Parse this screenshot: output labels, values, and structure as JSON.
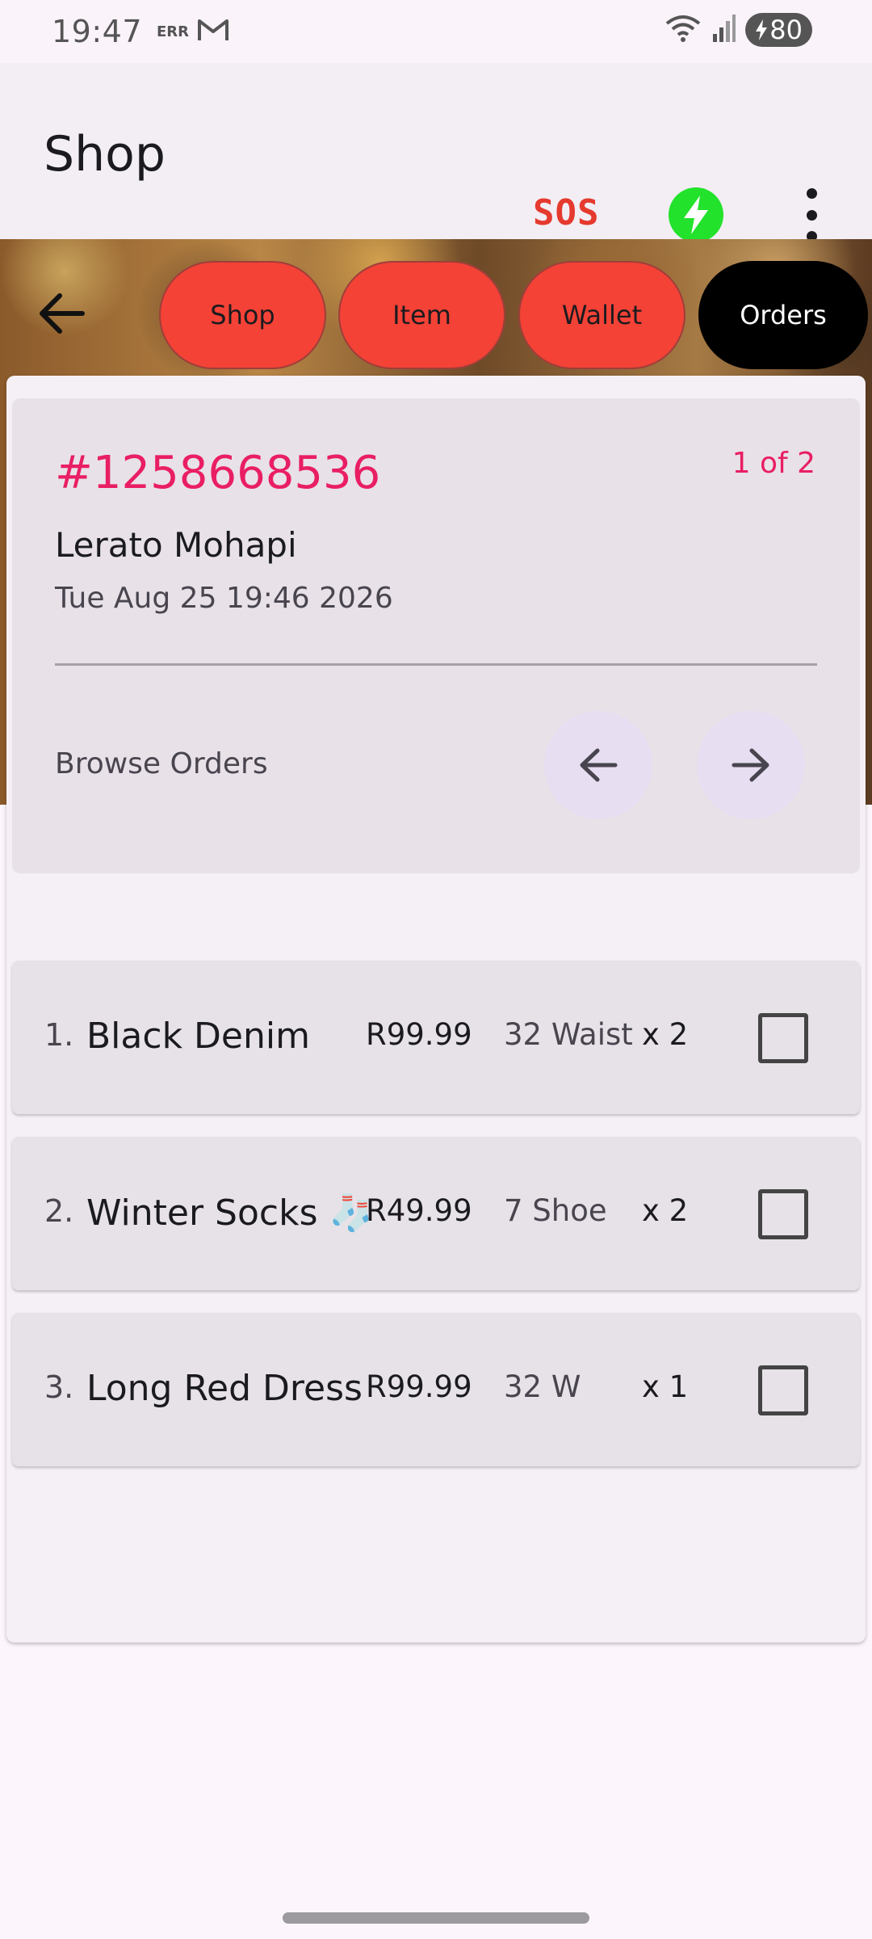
{
  "status_bar": {
    "time": "19:47",
    "carrier_text": "ERR",
    "battery": "80"
  },
  "app_bar": {
    "title": "Shop",
    "sos_label": "SOS"
  },
  "tabs": [
    {
      "label": "Shop",
      "active": false
    },
    {
      "label": "Item",
      "active": false
    },
    {
      "label": "Wallet",
      "active": false
    },
    {
      "label": "Orders",
      "active": true
    }
  ],
  "order": {
    "id": "#1258668536",
    "page_indicator": "1 of 2",
    "customer_name": "Lerato Mohapi",
    "datetime": "Tue Aug 25 19:46 2026",
    "browse_label": "Browse Orders"
  },
  "items": [
    {
      "num": "1.",
      "name": "Black Denim",
      "price": "R99.99",
      "size": "32 Waist",
      "qty": "x 2"
    },
    {
      "num": "2.",
      "name": "Winter Socks 🧦",
      "price": "R49.99",
      "size": "7 Shoe",
      "qty": "x 2"
    },
    {
      "num": "3.",
      "name": "Long Red Dress",
      "price": "R99.99",
      "size": "32 W",
      "qty": "x 1"
    }
  ],
  "colors": {
    "accent_pink": "#e91e63",
    "tab_red": "#f44236",
    "tab_active": "#000000",
    "bolt_green": "#22e22c",
    "sos_red": "#e53a2e"
  },
  "icons": {
    "back": "arrow-left-icon",
    "prev": "arrow-left-icon",
    "next": "arrow-right-icon",
    "bolt": "lightning-bolt-icon",
    "menu": "more-vertical-icon",
    "wifi": "wifi-icon",
    "signal": "signal-icon",
    "mail": "gmail-icon"
  }
}
